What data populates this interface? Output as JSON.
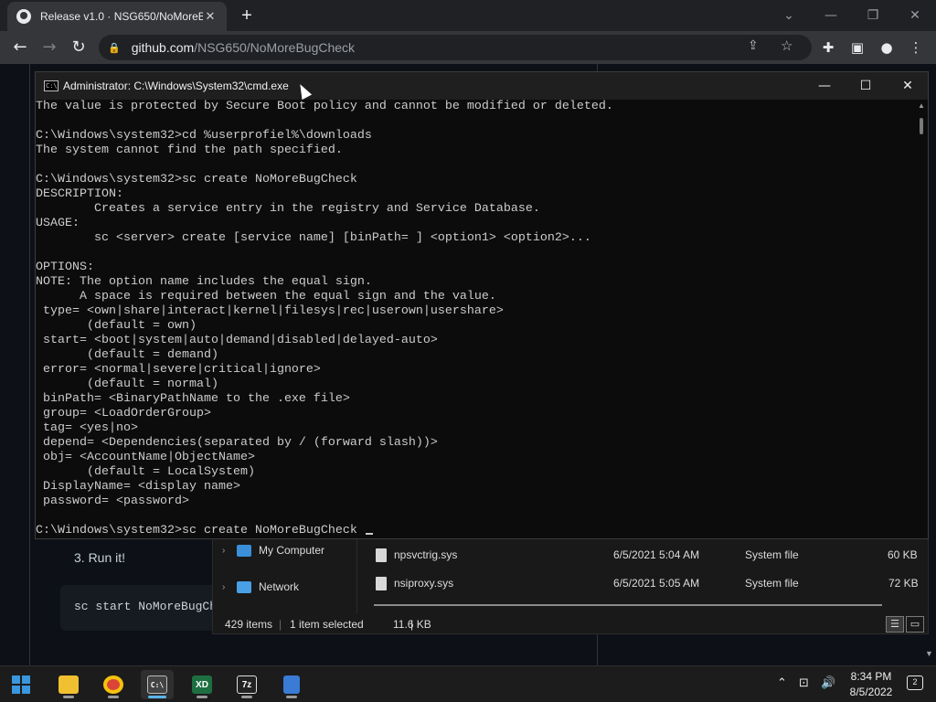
{
  "browser": {
    "tab_title": "Release v1.0 · NSG650/NoMoreB",
    "new_tab": "+",
    "url_host": "github.com",
    "url_path": "/NSG650/NoMoreBugCheck"
  },
  "github": {
    "step_text": "3. Run it!",
    "code_text": "sc start NoMoreBugCheck"
  },
  "explorer": {
    "nav_items": [
      {
        "label": "My Computer",
        "icon": "computer-icon"
      },
      {
        "label": "Network",
        "icon": "network-icon"
      }
    ],
    "files": [
      {
        "name": "npsvctrig.sys",
        "date": "6/5/2021 5:04 AM",
        "type": "System file",
        "size": "60 KB"
      },
      {
        "name": "nsiproxy.sys",
        "date": "6/5/2021 5:05 AM",
        "type": "System file",
        "size": "72 KB"
      }
    ],
    "status": {
      "items": "429 items",
      "selected": "1 item selected",
      "size": "11.6 KB"
    }
  },
  "cmd": {
    "title": "Administrator: C:\\Windows\\System32\\cmd.exe",
    "icon_text": "C:\\",
    "output": "The value is protected by Secure Boot policy and cannot be modified or deleted.\n\nC:\\Windows\\system32>cd %userprofiel%\\downloads\nThe system cannot find the path specified.\n\nC:\\Windows\\system32>sc create NoMoreBugCheck\nDESCRIPTION:\n        Creates a service entry in the registry and Service Database.\nUSAGE:\n        sc <server> create [service name] [binPath= ] <option1> <option2>...\n\nOPTIONS:\nNOTE: The option name includes the equal sign.\n      A space is required between the equal sign and the value.\n type= <own|share|interact|kernel|filesys|rec|userown|usershare>\n       (default = own)\n start= <boot|system|auto|demand|disabled|delayed-auto>\n       (default = demand)\n error= <normal|severe|critical|ignore>\n       (default = normal)\n binPath= <BinaryPathName to the .exe file>\n group= <LoadOrderGroup>\n tag= <yes|no>\n depend= <Dependencies(separated by / (forward slash))>\n obj= <AccountName|ObjectName>\n       (default = LocalSystem)\n DisplayName= <display name>\n password= <password>\n\nC:\\Windows\\system32>sc create NoMoreBugCheck "
  },
  "taskbar": {
    "apps": [
      {
        "name": "start",
        "icon": "windows-start-icon"
      },
      {
        "name": "file-explorer",
        "icon": "folder-icon",
        "color": "#f0c030"
      },
      {
        "name": "chrome",
        "icon": "chrome-icon",
        "color": "#db4437"
      },
      {
        "name": "terminal",
        "icon": "terminal-icon",
        "color": "#444444",
        "label": "C:\\"
      },
      {
        "name": "excel",
        "icon": "excel-icon",
        "color": "#1d6f42",
        "label": "XD"
      },
      {
        "name": "7zip",
        "icon": "7zip-icon",
        "color": "#222222",
        "label": "7z"
      },
      {
        "name": "notepad",
        "icon": "notepad-icon",
        "color": "#3a7bd5"
      }
    ],
    "time": "8:34 PM",
    "date": "8/5/2022",
    "notifications": "2"
  },
  "colors": {
    "github_bg": "#0d1117",
    "cmd_bg": "#0c0c0c",
    "cmd_text": "#cccccc",
    "accent": "#5ab4f0"
  }
}
